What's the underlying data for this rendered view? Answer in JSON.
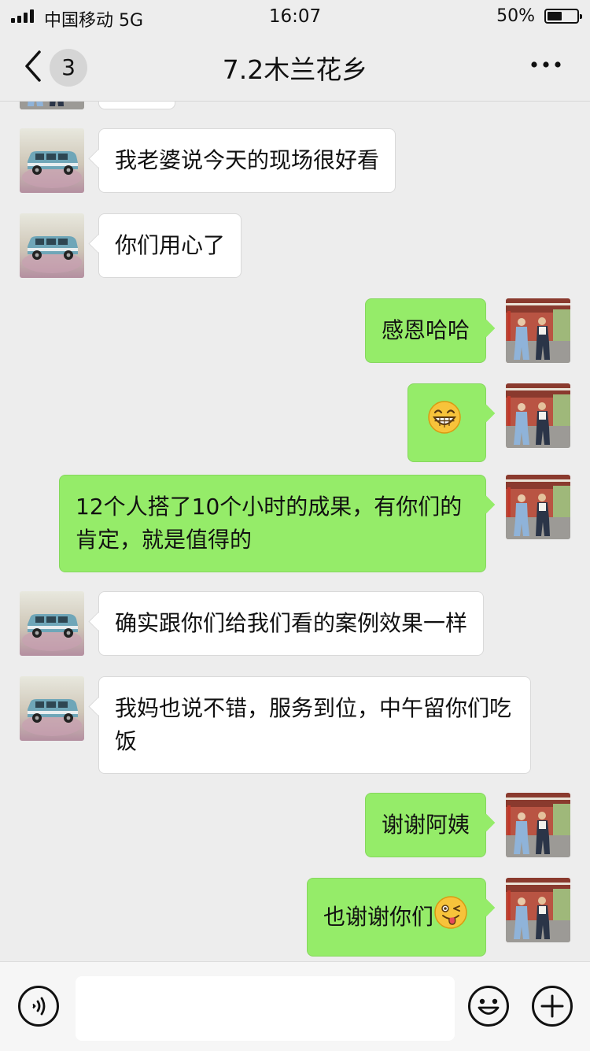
{
  "status_bar": {
    "carrier": "中国移动  5G",
    "time": "16:07",
    "battery": "50%",
    "battery_level": 0.5
  },
  "nav": {
    "badge": "3",
    "title": "7.2木兰花乡"
  },
  "icons": {
    "back": "chevron-left-icon",
    "more": "more-dots-icon",
    "voice": "voice-icon",
    "emoji": "smile-icon",
    "add": "plus-icon"
  },
  "colors": {
    "outgoing_bubble": "#95ec69",
    "incoming_bubble": "#ffffff",
    "background": "#ededed"
  },
  "messages": [
    {
      "side": "in",
      "text": "我老婆说今天的现场很好看"
    },
    {
      "side": "in",
      "text": "你们用心了"
    },
    {
      "side": "out",
      "text": "感恩哈哈"
    },
    {
      "side": "out",
      "text": "",
      "emoji": "grin-emoji"
    },
    {
      "side": "out",
      "text": "12个人搭了10个小时的成果，有你们的肯定，就是值得的"
    },
    {
      "side": "in",
      "text": "确实跟你们给我们看的案例效果一样"
    },
    {
      "side": "in",
      "text": "我妈也说不错，服务到位，中午留你们吃饭"
    },
    {
      "side": "out",
      "text": "谢谢阿姨"
    },
    {
      "side": "out",
      "text": "也谢谢你们",
      "emoji": "wink-tongue-emoji"
    }
  ]
}
